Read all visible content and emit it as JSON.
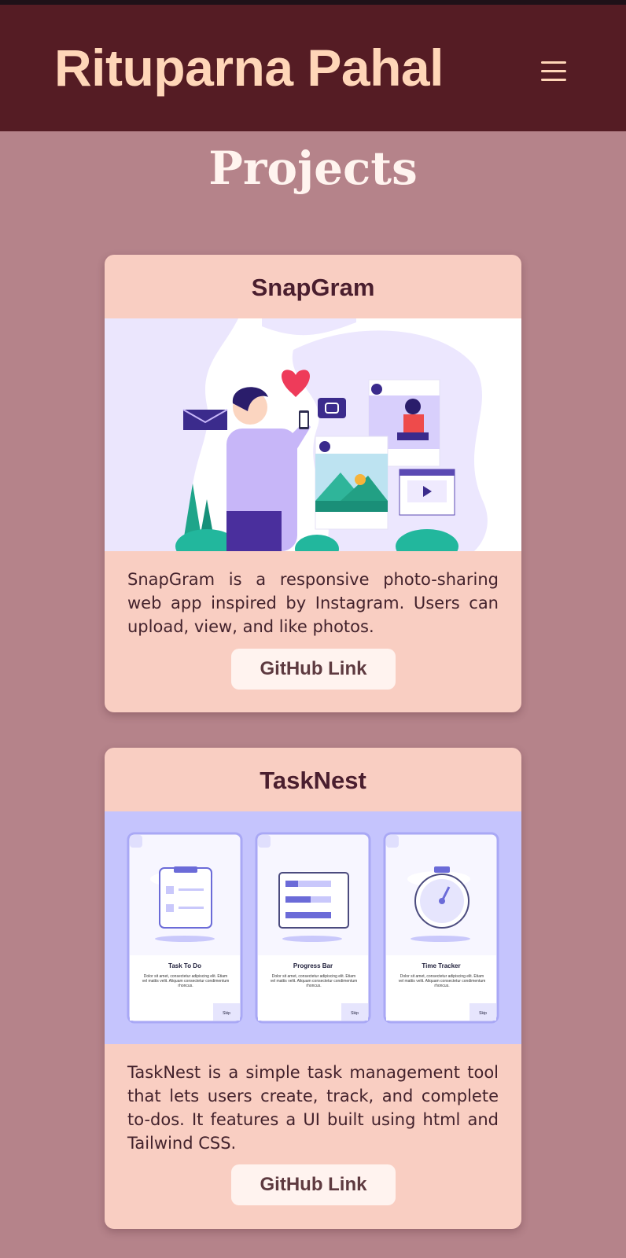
{
  "header": {
    "brand": "Rituparna Pahal",
    "menu_icon": "hamburger-menu-icon"
  },
  "projects": {
    "title": "Projects",
    "items": [
      {
        "title": "SnapGram",
        "description": "SnapGram is a responsive photo-sharing web app inspired by Instagram. Users can upload, view, and like photos.",
        "button": "GitHub Link"
      },
      {
        "title": "TaskNest",
        "description": "TaskNest is a simple task management tool that lets users create, track, and complete to-dos. It features a UI built using html and Tailwind CSS.",
        "button": "GitHub Link",
        "screens": [
          {
            "label": "Task To Do",
            "body": "Dolor sit amet, consectetur adipiscing elit. Etiam vel mattis velit. Aliquam consectetur condimentum rhoncus.",
            "skip": "Skip"
          },
          {
            "label": "Progress Bar",
            "body": "Dolor sit amet, consectetur adipiscing elit. Etiam vel mattis velit. Aliquam consectetur condimentum rhoncus.",
            "skip": "Skip"
          },
          {
            "label": "Time Tracker",
            "body": "Dolor sit amet, consectetur adipiscing elit. Etiam vel mattis velit. Aliquam consectetur condimentum rhoncus.",
            "skip": "Skip"
          }
        ]
      }
    ]
  },
  "colors": {
    "page_bg": "#b5838a",
    "header_bg": "#551c24",
    "brand_text": "#ffd6b8",
    "card_bg": "#f9cec2",
    "button_bg": "#fff3ef"
  }
}
